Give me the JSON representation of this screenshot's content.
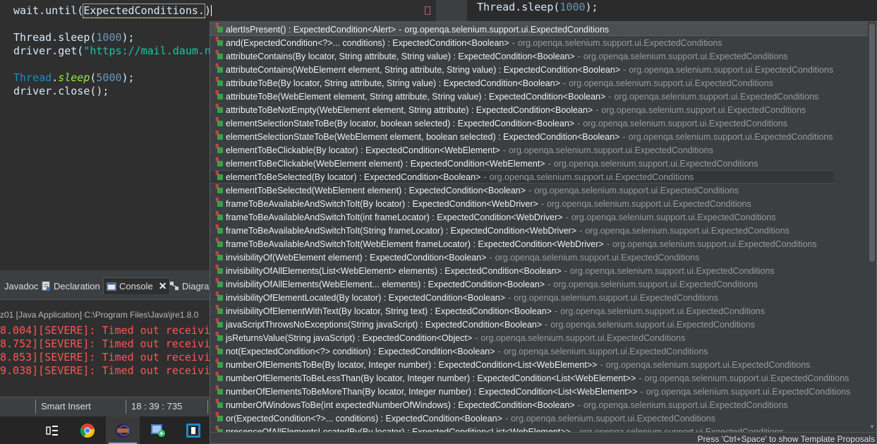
{
  "editor": {
    "line1_obj": "wait.until(",
    "line1_arg": "ExpectedConditions.",
    "line1_close": ")",
    "line2_a": "Thread.sleep(",
    "line2_num": "1000",
    "line2_b": ");",
    "line3_a": "driver.get(",
    "line3_str": "\"https://mail.daum.n",
    "line4_cls": "Thread",
    "line4_dot": ".",
    "line4_method": "sleep",
    "line4_paren": "(",
    "line4_num": "5000",
    "line4_end": ");",
    "line5": "driver.close();"
  },
  "right_editor": {
    "line_a": "Thread.sleep(",
    "line_num": "1000",
    "line_b": ");"
  },
  "tabs": {
    "javadoc": "Javadoc",
    "declaration": "Declaration",
    "console": "Console",
    "diagram": "Diagra"
  },
  "console": {
    "header": "z01 [Java Application] C:\\Program Files\\Java\\jre1.8.0",
    "lines": [
      "8.004][SEVERE]: Timed out receivi",
      "8.752][SEVERE]: Timed out receivi",
      "8.853][SEVERE]: Timed out receivi",
      "9.038][SEVERE]: Timed out receivi"
    ]
  },
  "status": {
    "insert_mode": "Smart Insert",
    "position": "18 : 39 : 735"
  },
  "taskbar": {
    "icons": [
      "task-view-icon",
      "chrome-icon",
      "eclipse-icon",
      "media-player-icon",
      "app-window-icon"
    ]
  },
  "assist": {
    "qualifier": "org.openqa.selenium.support.ui.ExpectedConditions",
    "dash": "-",
    "footer": "Press 'Ctrl+Space' to show Template Proposals",
    "proposals": [
      "alertIsPresent() : ExpectedCondition<Alert>",
      "and(ExpectedCondition<?>... conditions) : ExpectedCondition<Boolean>",
      "attributeContains(By locator, String attribute, String value) : ExpectedCondition<Boolean>",
      "attributeContains(WebElement element, String attribute, String value) : ExpectedCondition<Boolean>",
      "attributeToBe(By locator, String attribute, String value) : ExpectedCondition<Boolean>",
      "attributeToBe(WebElement element, String attribute, String value) : ExpectedCondition<Boolean>",
      "attributeToBeNotEmpty(WebElement element, String attribute) : ExpectedCondition<Boolean>",
      "elementSelectionStateToBe(By locator, boolean selected) : ExpectedCondition<Boolean>",
      "elementSelectionStateToBe(WebElement element, boolean selected) : ExpectedCondition<Boolean>",
      "elementToBeClickable(By locator) : ExpectedCondition<WebElement>",
      "elementToBeClickable(WebElement element) : ExpectedCondition<WebElement>",
      "elementToBeSelected(By locator) : ExpectedCondition<Boolean>",
      "elementToBeSelected(WebElement element) : ExpectedCondition<Boolean>",
      "frameToBeAvailableAndSwitchToIt(By locator) : ExpectedCondition<WebDriver>",
      "frameToBeAvailableAndSwitchToIt(int frameLocator) : ExpectedCondition<WebDriver>",
      "frameToBeAvailableAndSwitchToIt(String frameLocator) : ExpectedCondition<WebDriver>",
      "frameToBeAvailableAndSwitchToIt(WebElement frameLocator) : ExpectedCondition<WebDriver>",
      "invisibilityOf(WebElement element) : ExpectedCondition<Boolean>",
      "invisibilityOfAllElements(List<WebElement> elements) : ExpectedCondition<Boolean>",
      "invisibilityOfAllElements(WebElement... elements) : ExpectedCondition<Boolean>",
      "invisibilityOfElementLocated(By locator) : ExpectedCondition<Boolean>",
      "invisibilityOfElementWithText(By locator, String text) : ExpectedCondition<Boolean>",
      "javaScriptThrowsNoExceptions(String javaScript) : ExpectedCondition<Boolean>",
      "jsReturnsValue(String javaScript) : ExpectedCondition<Object>",
      "not(ExpectedCondition<?> condition) : ExpectedCondition<Boolean>",
      "numberOfElementsToBe(By locator, Integer number) : ExpectedCondition<List<WebElement>>",
      "numberOfElementsToBeLessThan(By locator, Integer number) : ExpectedCondition<List<WebElement>>",
      "numberOfElementsToBeMoreThan(By locator, Integer number) : ExpectedCondition<List<WebElement>>",
      "numberOfWindowsToBe(int expectedNumberOfWindows) : ExpectedCondition<Boolean>",
      "or(ExpectedCondition<?>... conditions) : ExpectedCondition<Boolean>",
      "presenceOfAllElementsLocatedBy(By locator) : ExpectedCondition<List<WebElement>>"
    ],
    "selected_index": 0,
    "hover_index": 11
  }
}
